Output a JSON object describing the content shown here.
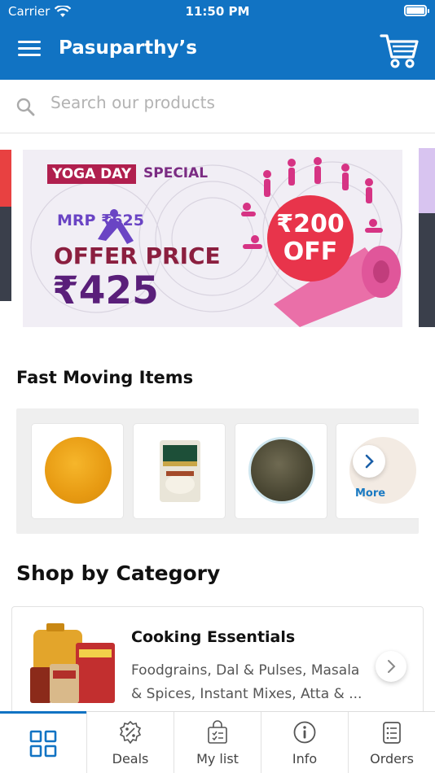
{
  "status": {
    "carrier": "Carrier",
    "time": "11:50 PM"
  },
  "header": {
    "title": "Pasuparthy’s"
  },
  "search": {
    "placeholder": "Search our products"
  },
  "banner": {
    "tag": "YOGA DAY",
    "special": "SPECIAL",
    "mrp": "MRP ₹625",
    "offer": "OFFER PRICE",
    "price": "₹425",
    "badge_amount": "₹200",
    "badge_off": "OFF"
  },
  "fast_moving": {
    "title": "Fast Moving Items",
    "items": [
      "toor-dal",
      "india-gate-basmati-rice",
      "mustard-seeds"
    ],
    "more_label": "More"
  },
  "category": {
    "title": "Shop by Category",
    "card": {
      "title": "Cooking Essentials",
      "description": "Foodgrains, Dal & Pulses, Masala & Spices, Instant Mixes, Atta & ..."
    }
  },
  "tabs": [
    {
      "label": "",
      "icon": "grid-icon",
      "active": true
    },
    {
      "label": "Deals",
      "icon": "percent-badge-icon"
    },
    {
      "label": "My list",
      "icon": "shopping-bag-list-icon"
    },
    {
      "label": "Info",
      "icon": "info-icon"
    },
    {
      "label": "Orders",
      "icon": "orders-list-icon"
    }
  ],
  "colors": {
    "brand": "#1173c3",
    "banner_red": "#e8344b"
  }
}
